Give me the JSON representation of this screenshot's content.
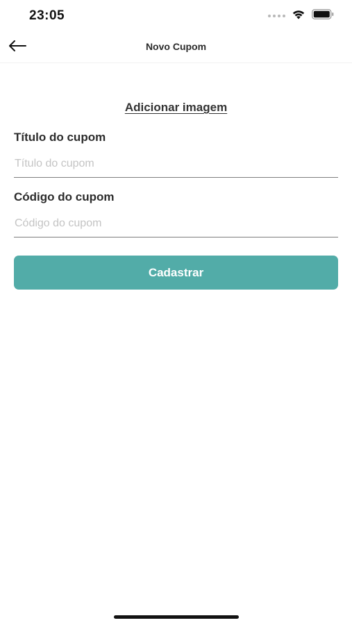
{
  "status_bar": {
    "time": "23:05",
    "icons": [
      "signal-icon",
      "wifi-icon",
      "battery-icon"
    ]
  },
  "nav": {
    "back_icon": "arrow-left-icon",
    "title": "Novo Cupom"
  },
  "form": {
    "add_image_label": "Adicionar imagem",
    "title_field": {
      "label": "Título do cupom",
      "placeholder": "Título do cupom",
      "value": ""
    },
    "code_field": {
      "label": "Código do cupom",
      "placeholder": "Código do cupom",
      "value": ""
    },
    "submit_label": "Cadastrar"
  },
  "colors": {
    "accent": "#52aca8",
    "text": "#2b2b2b",
    "placeholder": "#c4c4c4",
    "divider": "#7d7d7d"
  }
}
